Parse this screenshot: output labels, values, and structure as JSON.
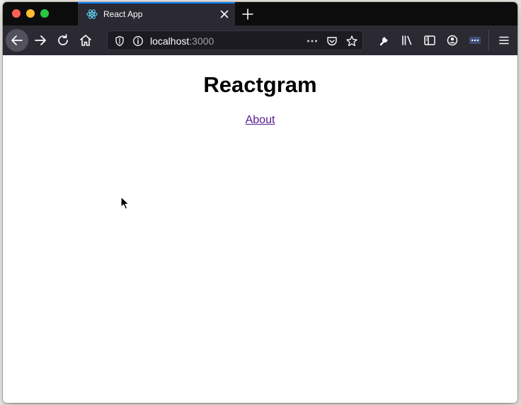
{
  "browser": {
    "tab": {
      "title": "React App"
    },
    "address": {
      "host": "localhost",
      "port": ":3000"
    }
  },
  "page": {
    "title": "Reactgram",
    "nav": {
      "about": "About"
    }
  },
  "colors": {
    "tab_accent": "#0a84ff",
    "toolbar_bg": "#2b2a33",
    "titlebar_bg": "#0c0c0d",
    "visited_link": "#551a8b"
  },
  "icons": {
    "tab": "react-logo-icon",
    "toolbar": [
      "back-arrow-icon",
      "forward-arrow-icon",
      "reload-icon",
      "home-icon",
      "shield-icon",
      "info-icon",
      "more-dots-icon",
      "pocket-icon",
      "bookmark-star-icon",
      "wrench-icon",
      "library-icon",
      "sidebar-icon",
      "account-icon",
      "extension-icon",
      "hamburger-menu-icon"
    ]
  }
}
